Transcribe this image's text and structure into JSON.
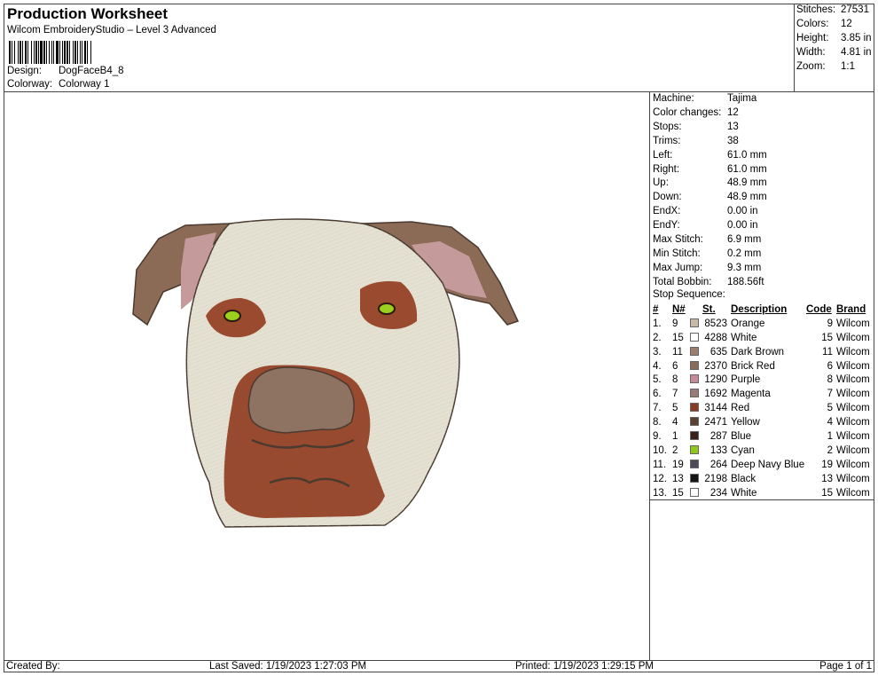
{
  "header": {
    "title": "Production Worksheet",
    "subtitle": "Wilcom EmbroideryStudio – Level 3 Advanced",
    "design_label": "Design:",
    "design_value": "DogFaceB4_8",
    "colorway_label": "Colorway:",
    "colorway_value": "Colorway 1"
  },
  "summary": [
    {
      "label": "Stitches:",
      "value": "27531"
    },
    {
      "label": "Colors:",
      "value": "12"
    },
    {
      "label": "Height:",
      "value": "3.85 in"
    },
    {
      "label": "Width:",
      "value": "4.81 in"
    },
    {
      "label": "Zoom:",
      "value": "1:1"
    }
  ],
  "specs": [
    {
      "label": "Machine:",
      "value": "Tajima"
    },
    {
      "label": "Color changes:",
      "value": "12"
    },
    {
      "label": "Stops:",
      "value": "13"
    },
    {
      "label": "Trims:",
      "value": "38"
    },
    {
      "label": "Left:",
      "value": "61.0 mm"
    },
    {
      "label": "Right:",
      "value": "61.0 mm"
    },
    {
      "label": "Up:",
      "value": "48.9 mm"
    },
    {
      "label": "Down:",
      "value": "48.9 mm"
    },
    {
      "label": "EndX:",
      "value": "0.00 in"
    },
    {
      "label": "EndY:",
      "value": "0.00 in"
    },
    {
      "label": "Max Stitch:",
      "value": "6.9 mm"
    },
    {
      "label": "Min Stitch:",
      "value": "0.2 mm"
    },
    {
      "label": "Max Jump:",
      "value": "9.3 mm"
    },
    {
      "label": "Total Bobbin:",
      "value": "188.56ft"
    }
  ],
  "stop_sequence": {
    "title": "Stop Sequence:",
    "headers": {
      "idx": "#",
      "n": "N#",
      "st": "St.",
      "desc": "Description",
      "code": "Code",
      "brand": "Brand"
    },
    "rows": [
      {
        "idx": "1.",
        "n": "9",
        "color": "#c8b8a8",
        "st": "8523",
        "desc": "Orange",
        "code": "9",
        "brand": "Wilcom"
      },
      {
        "idx": "2.",
        "n": "15",
        "color": "#ffffff",
        "st": "4288",
        "desc": "White",
        "code": "15",
        "brand": "Wilcom"
      },
      {
        "idx": "3.",
        "n": "11",
        "color": "#9c7e6e",
        "st": "635",
        "desc": "Dark Brown",
        "code": "11",
        "brand": "Wilcom"
      },
      {
        "idx": "4.",
        "n": "6",
        "color": "#8a6a58",
        "st": "2370",
        "desc": "Brick Red",
        "code": "6",
        "brand": "Wilcom"
      },
      {
        "idx": "5.",
        "n": "8",
        "color": "#c88a98",
        "st": "1290",
        "desc": "Purple",
        "code": "8",
        "brand": "Wilcom"
      },
      {
        "idx": "6.",
        "n": "7",
        "color": "#9a7a74",
        "st": "1692",
        "desc": "Magenta",
        "code": "7",
        "brand": "Wilcom"
      },
      {
        "idx": "7.",
        "n": "5",
        "color": "#8a3a24",
        "st": "3144",
        "desc": "Red",
        "code": "5",
        "brand": "Wilcom"
      },
      {
        "idx": "8.",
        "n": "4",
        "color": "#5a4030",
        "st": "2471",
        "desc": "Yellow",
        "code": "4",
        "brand": "Wilcom"
      },
      {
        "idx": "9.",
        "n": "1",
        "color": "#3a2216",
        "st": "287",
        "desc": "Blue",
        "code": "1",
        "brand": "Wilcom"
      },
      {
        "idx": "10.",
        "n": "2",
        "color": "#8fc81c",
        "st": "133",
        "desc": "Cyan",
        "code": "2",
        "brand": "Wilcom"
      },
      {
        "idx": "11.",
        "n": "19",
        "color": "#4a4a5a",
        "st": "264",
        "desc": "Deep Navy Blue",
        "code": "19",
        "brand": "Wilcom"
      },
      {
        "idx": "12.",
        "n": "13",
        "color": "#141414",
        "st": "2198",
        "desc": "Black",
        "code": "13",
        "brand": "Wilcom"
      },
      {
        "idx": "13.",
        "n": "15",
        "color": "#ffffff",
        "st": "234",
        "desc": "White",
        "code": "15",
        "brand": "Wilcom"
      }
    ]
  },
  "footer": {
    "created_by": "Created By:",
    "last_saved": "Last Saved: 1/19/2023 1:27:03 PM",
    "printed": "Printed: 1/19/2023 1:29:15 PM",
    "page": "Page 1 of 1"
  },
  "design_preview": {
    "colors": {
      "face": "#e4e1d2",
      "ear_outer": "#8b6b55",
      "ear_inner": "#c59a9a",
      "patch": "#9a4a2e",
      "nose": "#8e7262",
      "outline": "#4a3a30",
      "eye": "#9bd020"
    }
  }
}
